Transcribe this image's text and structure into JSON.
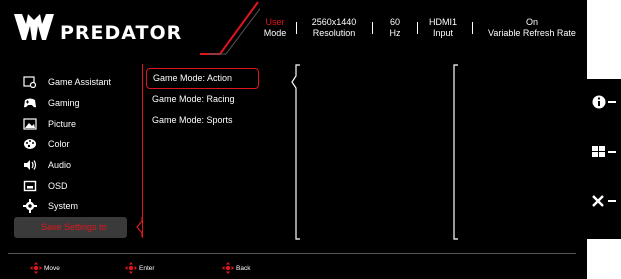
{
  "brand": {
    "name": "PREDATOR"
  },
  "status": [
    {
      "value": "User",
      "label": "Mode",
      "value_color": "#e0161d"
    },
    {
      "value": "2560x1440",
      "label": "Resolution"
    },
    {
      "value": "60",
      "label": "Hz"
    },
    {
      "value": "HDMI1",
      "label": "Input"
    },
    {
      "value": "On",
      "label": "Variable Refresh Rate"
    }
  ],
  "menu": {
    "items": [
      {
        "label": "Game Assistant",
        "icon": "game-assistant-icon"
      },
      {
        "label": "Gaming",
        "icon": "gamepad-icon"
      },
      {
        "label": "Picture",
        "icon": "picture-icon"
      },
      {
        "label": "Color",
        "icon": "palette-icon"
      },
      {
        "label": "Audio",
        "icon": "speaker-icon"
      },
      {
        "label": "OSD",
        "icon": "osd-icon"
      },
      {
        "label": "System",
        "icon": "gear-icon"
      },
      {
        "label": "Save Settings to",
        "icon": ""
      }
    ]
  },
  "submenu": {
    "items": [
      "Game Mode: Action",
      "Game Mode: Racing",
      "Game Mode: Sports"
    ]
  },
  "footer": {
    "move": "Move",
    "enter": "Enter",
    "back": "Back"
  },
  "side_buttons": {
    "icons": [
      "info-icon",
      "input-source-icon",
      "close-icon"
    ]
  },
  "colors": {
    "accent": "#e0161d",
    "background": "#000000"
  }
}
